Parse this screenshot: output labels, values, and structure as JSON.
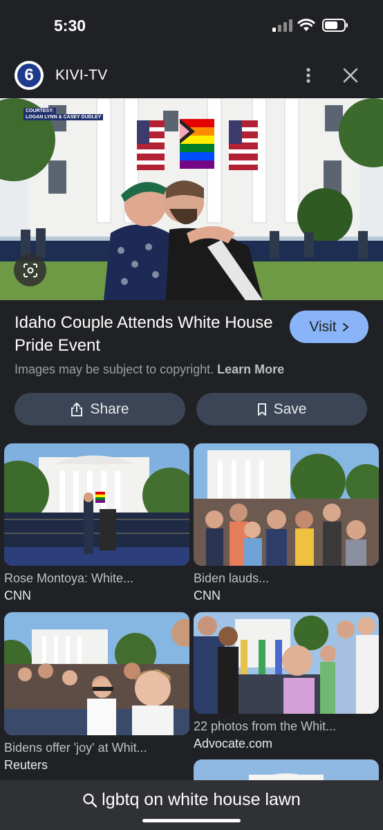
{
  "status_bar": {
    "time": "5:30"
  },
  "header": {
    "source_name": "KIVI-TV",
    "logo_text": "6"
  },
  "hero": {
    "credit_line1": "COURTESY:",
    "credit_line2": "LOGAN LYNN & CASEY DUDLEY"
  },
  "result": {
    "title": "Idaho Couple Attends White House Pride Event",
    "visit_label": "Visit",
    "copyright_text": "Images may be subject to copyright.",
    "learn_more": "Learn More",
    "share_label": "Share",
    "save_label": "Save"
  },
  "related": [
    {
      "title": "Rose Montoya: White...",
      "source": "CNN"
    },
    {
      "title": "Biden lauds...",
      "source": "CNN"
    },
    {
      "title": "Bidens offer 'joy' at Whit...",
      "source": "Reuters"
    },
    {
      "title": "22 photos from the Whit...",
      "source": "Advocate.com"
    }
  ],
  "search": {
    "query": "lgbtq on white house lawn"
  },
  "colors": {
    "background": "#202124",
    "accent": "#8ab4f8",
    "button_bg": "#3c4555",
    "bottom_bar": "#303134"
  },
  "icons": [
    "signal-icon",
    "wifi-icon",
    "battery-icon",
    "more-vert-icon",
    "close-icon",
    "lens-icon",
    "share-icon",
    "bookmark-icon",
    "chevron-right-icon",
    "search-icon"
  ]
}
